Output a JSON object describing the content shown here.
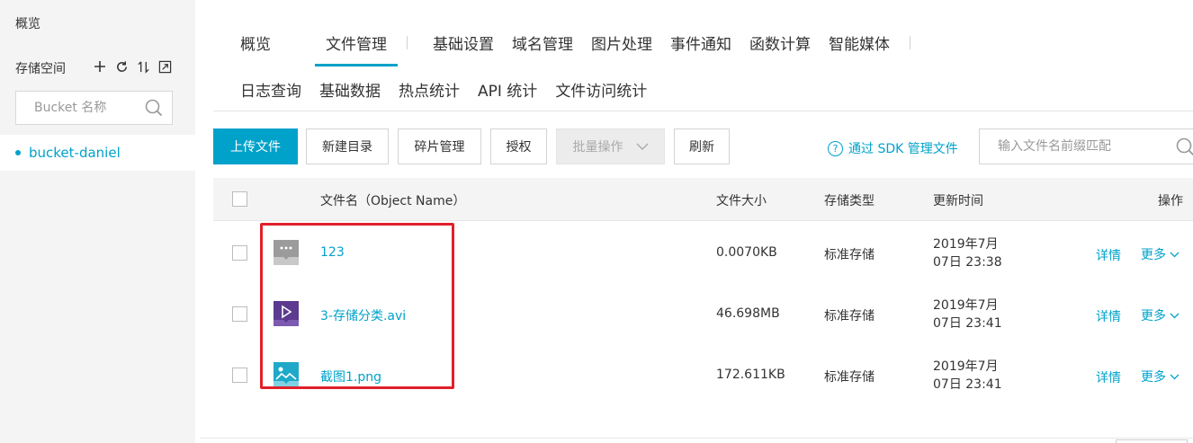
{
  "sidebar": {
    "overview": "概览",
    "space_label": "存储空间",
    "tools": [
      "add-icon",
      "refresh-icon",
      "sort-icon",
      "expand-icon"
    ],
    "search_placeholder": "Bucket 名称",
    "bucket": "bucket-daniel"
  },
  "tabs_row1": [
    "概览",
    "文件管理",
    "基础设置",
    "域名管理",
    "图片处理",
    "事件通知",
    "函数计算",
    "智能媒体"
  ],
  "tabs_row2": [
    "日志查询",
    "基础数据",
    "热点统计",
    "API 统计",
    "文件访问统计"
  ],
  "active_tab": "文件管理",
  "toolbar": {
    "upload": "上传文件",
    "new_dir": "新建目录",
    "fragments": "碎片管理",
    "authorize": "授权",
    "batch": "批量操作",
    "refresh": "刷新",
    "sdk_link": "通过 SDK 管理文件",
    "search_placeholder": "输入文件名前缀匹配"
  },
  "table": {
    "headers": {
      "name": "文件名（Object Name）",
      "size": "文件大小",
      "type": "存储类型",
      "time": "更新时间",
      "ops": "操作"
    },
    "rows": [
      {
        "icon": "file-icon",
        "name": "123",
        "size": "0.0070KB",
        "storage": "标准存储",
        "time1": "2019年7月",
        "time2": "07日 23:38",
        "detail": "详情",
        "more": "更多"
      },
      {
        "icon": "video-icon",
        "name": "3-存储分类.avi",
        "size": "46.698MB",
        "storage": "标准存储",
        "time1": "2019年7月",
        "time2": "07日 23:41",
        "detail": "详情",
        "more": "更多"
      },
      {
        "icon": "image-icon",
        "name": "截图1.png",
        "size": "172.611KB",
        "storage": "标准存储",
        "time1": "2019年7月",
        "time2": "07日 23:41",
        "detail": "详情",
        "more": "更多"
      }
    ]
  },
  "colors": {
    "accent": "#00a2ca",
    "highlight": "#e0202b"
  }
}
